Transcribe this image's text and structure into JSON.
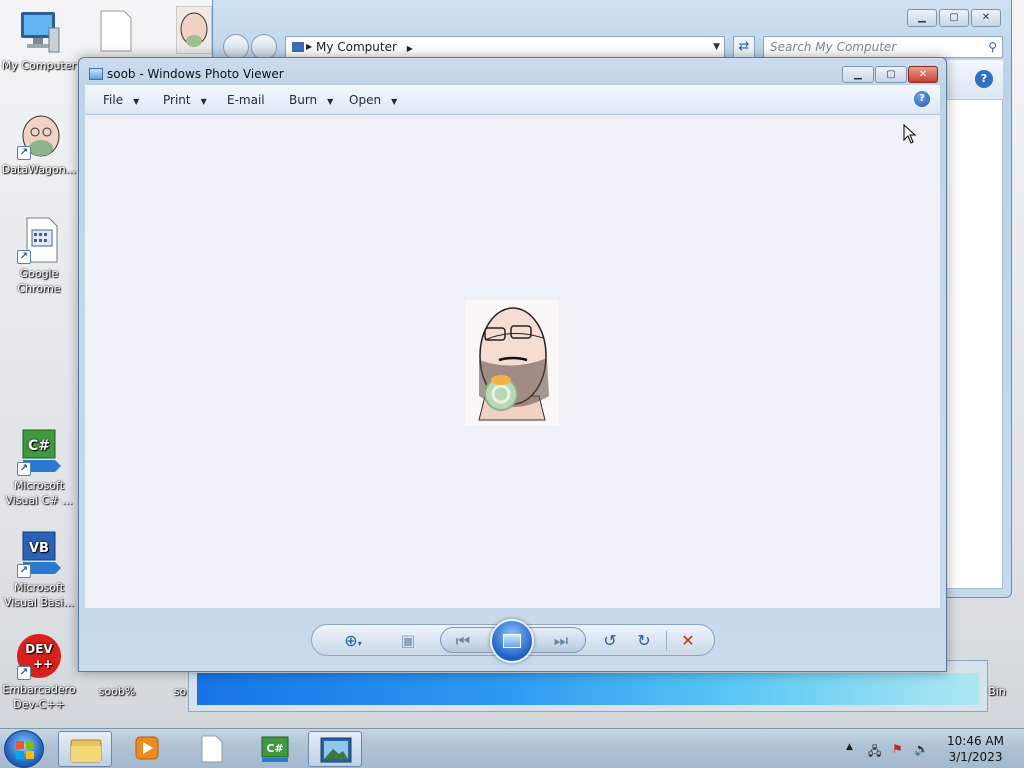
{
  "desktop": {
    "icons": [
      {
        "label": "My Computer"
      },
      {
        "label": "DataWagon..."
      },
      {
        "label": "Google Chrome"
      },
      {
        "label": "Microsoft Visual C# ..."
      },
      {
        "label": "Microsoft Visual Basi..."
      },
      {
        "label": "Embarcadero Dev-C++"
      },
      {
        "label": "soob%"
      },
      {
        "label": "so"
      },
      {
        "label": "Bin"
      }
    ]
  },
  "explorer": {
    "breadcrumb": "My Computer",
    "search_placeholder": "Search My Computer"
  },
  "viewer": {
    "title": "soob - Windows Photo Viewer",
    "menu": [
      {
        "label": "File",
        "has_dropdown": true
      },
      {
        "label": "Print",
        "has_dropdown": true
      },
      {
        "label": "E-mail",
        "has_dropdown": false
      },
      {
        "label": "Burn",
        "has_dropdown": true
      },
      {
        "label": "Open",
        "has_dropdown": true
      }
    ],
    "help_label": "?",
    "controls": {
      "zoom_icon": "zoom-icon",
      "actual_size_icon": "actual-size-icon",
      "previous_icon": "previous-icon",
      "slideshow_icon": "slideshow-icon",
      "next_icon": "next-icon",
      "rotate_ccw_icon": "rotate-counterclockwise-icon",
      "rotate_cw_icon": "rotate-clockwise-icon",
      "delete_icon": "delete-icon"
    }
  },
  "taskbar": {
    "time": "10:46 AM",
    "date": "3/1/2023",
    "apps": [
      "windows-explorer",
      "media-player",
      "document",
      "visual-csharp",
      "photo-viewer"
    ]
  }
}
